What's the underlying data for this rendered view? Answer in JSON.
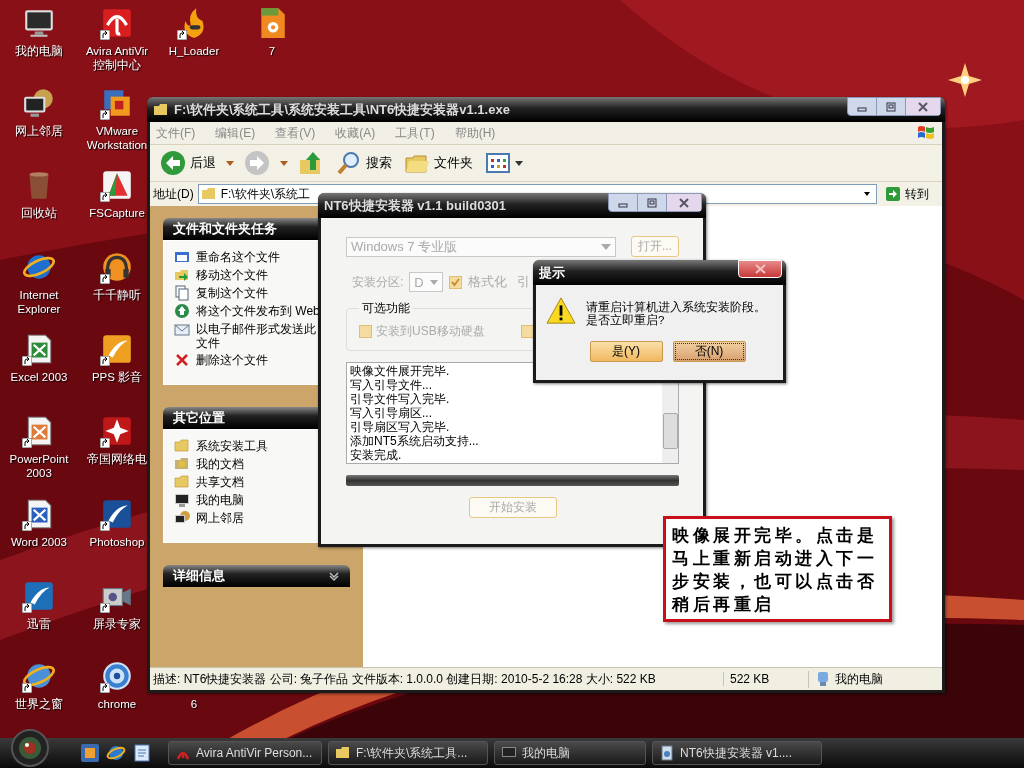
{
  "desktop_icons": [
    {
      "label": "我的电脑",
      "kind": "icon",
      "shortcut": false
    },
    {
      "label": "网上邻居",
      "kind": "icon",
      "shortcut": false
    },
    {
      "label": "回收站",
      "kind": "icon",
      "shortcut": false
    },
    {
      "label": "Internet Explorer",
      "kind": "icon",
      "shortcut": false
    },
    {
      "label": "Excel 2003",
      "kind": "icon",
      "shortcut": true
    },
    {
      "label": "PowerPoint 2003",
      "kind": "icon",
      "shortcut": true
    },
    {
      "label": "Word 2003",
      "kind": "icon",
      "shortcut": true
    },
    {
      "label": "迅雷",
      "kind": "icon",
      "shortcut": true
    },
    {
      "label": "世界之窗",
      "kind": "icon",
      "shortcut": true
    },
    {
      "label": "Avira AntiVir 控制中心",
      "kind": "icon",
      "shortcut": true
    },
    {
      "label": "VMware Workstation",
      "kind": "icon",
      "shortcut": true
    },
    {
      "label": "FSCapture",
      "kind": "icon",
      "shortcut": true
    },
    {
      "label": "千千静听",
      "kind": "icon",
      "shortcut": true
    },
    {
      "label": "PPS 影音",
      "kind": "icon",
      "shortcut": true
    },
    {
      "label": "帝国网络电",
      "kind": "icon",
      "shortcut": true
    },
    {
      "label": "Photoshop",
      "kind": "icon",
      "shortcut": true
    },
    {
      "label": "屏录专家",
      "kind": "icon",
      "shortcut": true
    },
    {
      "label": "chrome",
      "kind": "icon",
      "shortcut": true
    },
    {
      "label": "H_Loader",
      "kind": "icon",
      "shortcut": true
    },
    {
      "label": "7",
      "kind": "icon",
      "shortcut": false
    },
    {
      "label": "6",
      "kind": "label"
    }
  ],
  "explorer": {
    "title": "F:\\软件夹\\系统工具\\系统安装工具\\NT6快捷安装器v1.1.exe",
    "menu": [
      "文件(F)",
      "编辑(E)",
      "查看(V)",
      "收藏(A)",
      "工具(T)",
      "帮助(H)"
    ],
    "toolbar": [
      {
        "kind": "back",
        "label": "后退",
        "disabled": false
      },
      {
        "kind": "forward",
        "disabled": true
      },
      {
        "kind": "up"
      },
      {
        "kind": "search",
        "label": "搜索"
      },
      {
        "kind": "folders",
        "label": "文件夹"
      },
      {
        "kind": "views"
      }
    ],
    "address_label": "地址(D)",
    "address": "F:\\软件夹\\系统工",
    "go_button": "转到",
    "panels": [
      {
        "title": "文件和文件夹任务",
        "expanded": true,
        "items": [
          "重命名这个文件",
          "移动这个文件",
          "复制这个文件",
          "将这个文件发布到 Web",
          "以电子邮件形式发送此文件",
          "删除这个文件"
        ]
      },
      {
        "title": "其它位置",
        "expanded": true,
        "items": [
          "系统安装工具",
          "我的文档",
          "共享文档",
          "我的电脑",
          "网上邻居"
        ]
      },
      {
        "title": "详细信息",
        "expanded": false
      }
    ],
    "status": [
      "描述: NT6快捷安装器 公司: 兔子作品 文件版本: 1.0.0.0 创建日期: 2010-5-2 16:28 大小: 522 KB",
      "522 KB",
      "我的电脑"
    ]
  },
  "installer": {
    "title": "NT6快捷安装器 v1.1 build0301",
    "disabled": true,
    "edition": "Windows 7 专业版",
    "open_button": "打开...",
    "partition_label": "安装分区:",
    "partition": "D",
    "format": {
      "label": "格式化",
      "checked": true
    },
    "cut_label": "引",
    "options_title": "可选功能",
    "options": [
      {
        "label": "安装到USB移动硬盘",
        "checked": false
      },
      {
        "checked": false
      }
    ],
    "log": [
      "映像文件展开完毕.",
      "写入引导文件...",
      "引导文件写入完毕.",
      "写入引导扇区...",
      "引导扇区写入完毕.",
      "添加NT5系统启动支持...",
      "安装完成."
    ],
    "progress": {
      "level": 1
    },
    "start_button": "开始安装"
  },
  "prompt": {
    "title": "提示",
    "message": [
      "请重启计算机进入系统安装阶段。",
      "是否立即重启?"
    ],
    "buttons": [
      {
        "label": "是(Y)",
        "focused": false
      },
      {
        "label": "否(N)",
        "focused": true
      }
    ]
  },
  "callout": {
    "text": "映像展开完毕。点击是马上重新启动进入下一步安装，也可以点击否稍后再重启"
  },
  "taskbar": {
    "tasks": [
      "Avira AntiVir Person...",
      "F:\\软件夹\\系统工具...",
      "我的电脑",
      "NT6快捷安装器 v1...."
    ]
  }
}
